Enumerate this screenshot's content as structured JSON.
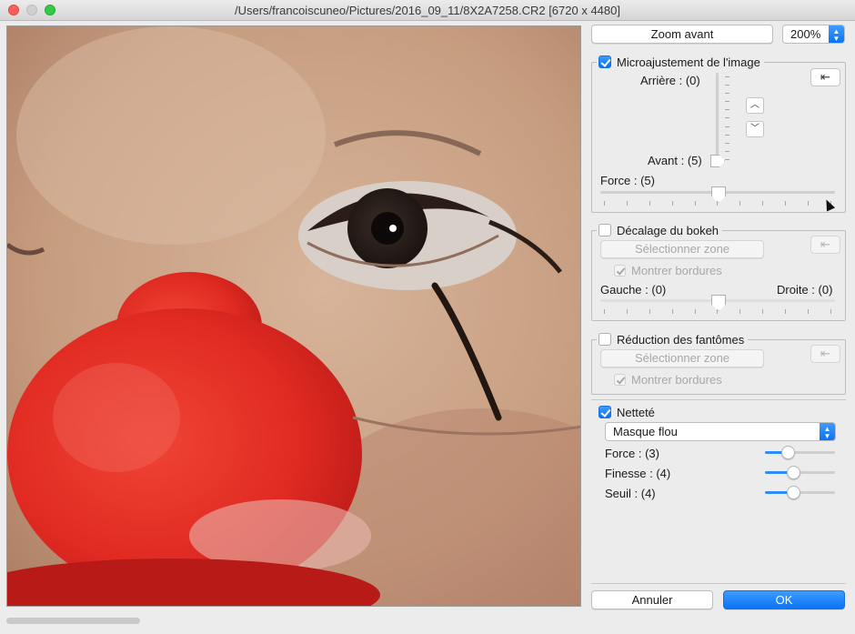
{
  "window": {
    "title": "/Users/francoiscuneo/Pictures/2016_09_11/8X2A7258.CR2 [6720 x 4480]"
  },
  "toolbar": {
    "zoom_in_label": "Zoom avant",
    "zoom_value": "200%"
  },
  "micro": {
    "enabled": true,
    "title": "Microajustement de l'image",
    "back_label": "Arrière : (0)",
    "front_label": "Avant : (5)",
    "force_label": "Force : (5)",
    "force_value": 5,
    "vertical_value": 5,
    "reset_icon": "reset-arrow-icon"
  },
  "bokeh": {
    "enabled": false,
    "title": "Décalage du bokeh",
    "select_zone_label": "Sélectionner zone",
    "show_borders_label": "Montrer bordures",
    "left_label": "Gauche : (0)",
    "right_label": "Droite : (0)",
    "reset_icon": "reset-arrow-icon"
  },
  "ghost": {
    "enabled": false,
    "title": "Réduction des fantômes",
    "select_zone_label": "Sélectionner zone",
    "show_borders_label": "Montrer bordures",
    "reset_icon": "reset-arrow-icon"
  },
  "sharpness": {
    "enabled": true,
    "title": "Netteté",
    "method_value": "Masque flou",
    "sliders": [
      {
        "label": "Force : (3)",
        "value": 3
      },
      {
        "label": "Finesse : (4)",
        "value": 4
      },
      {
        "label": "Seuil : (4)",
        "value": 4
      }
    ]
  },
  "footer": {
    "cancel_label": "Annuler",
    "ok_label": "OK"
  },
  "colors": {
    "accent": "#0a74f5",
    "nose_red": "#e8322b"
  }
}
